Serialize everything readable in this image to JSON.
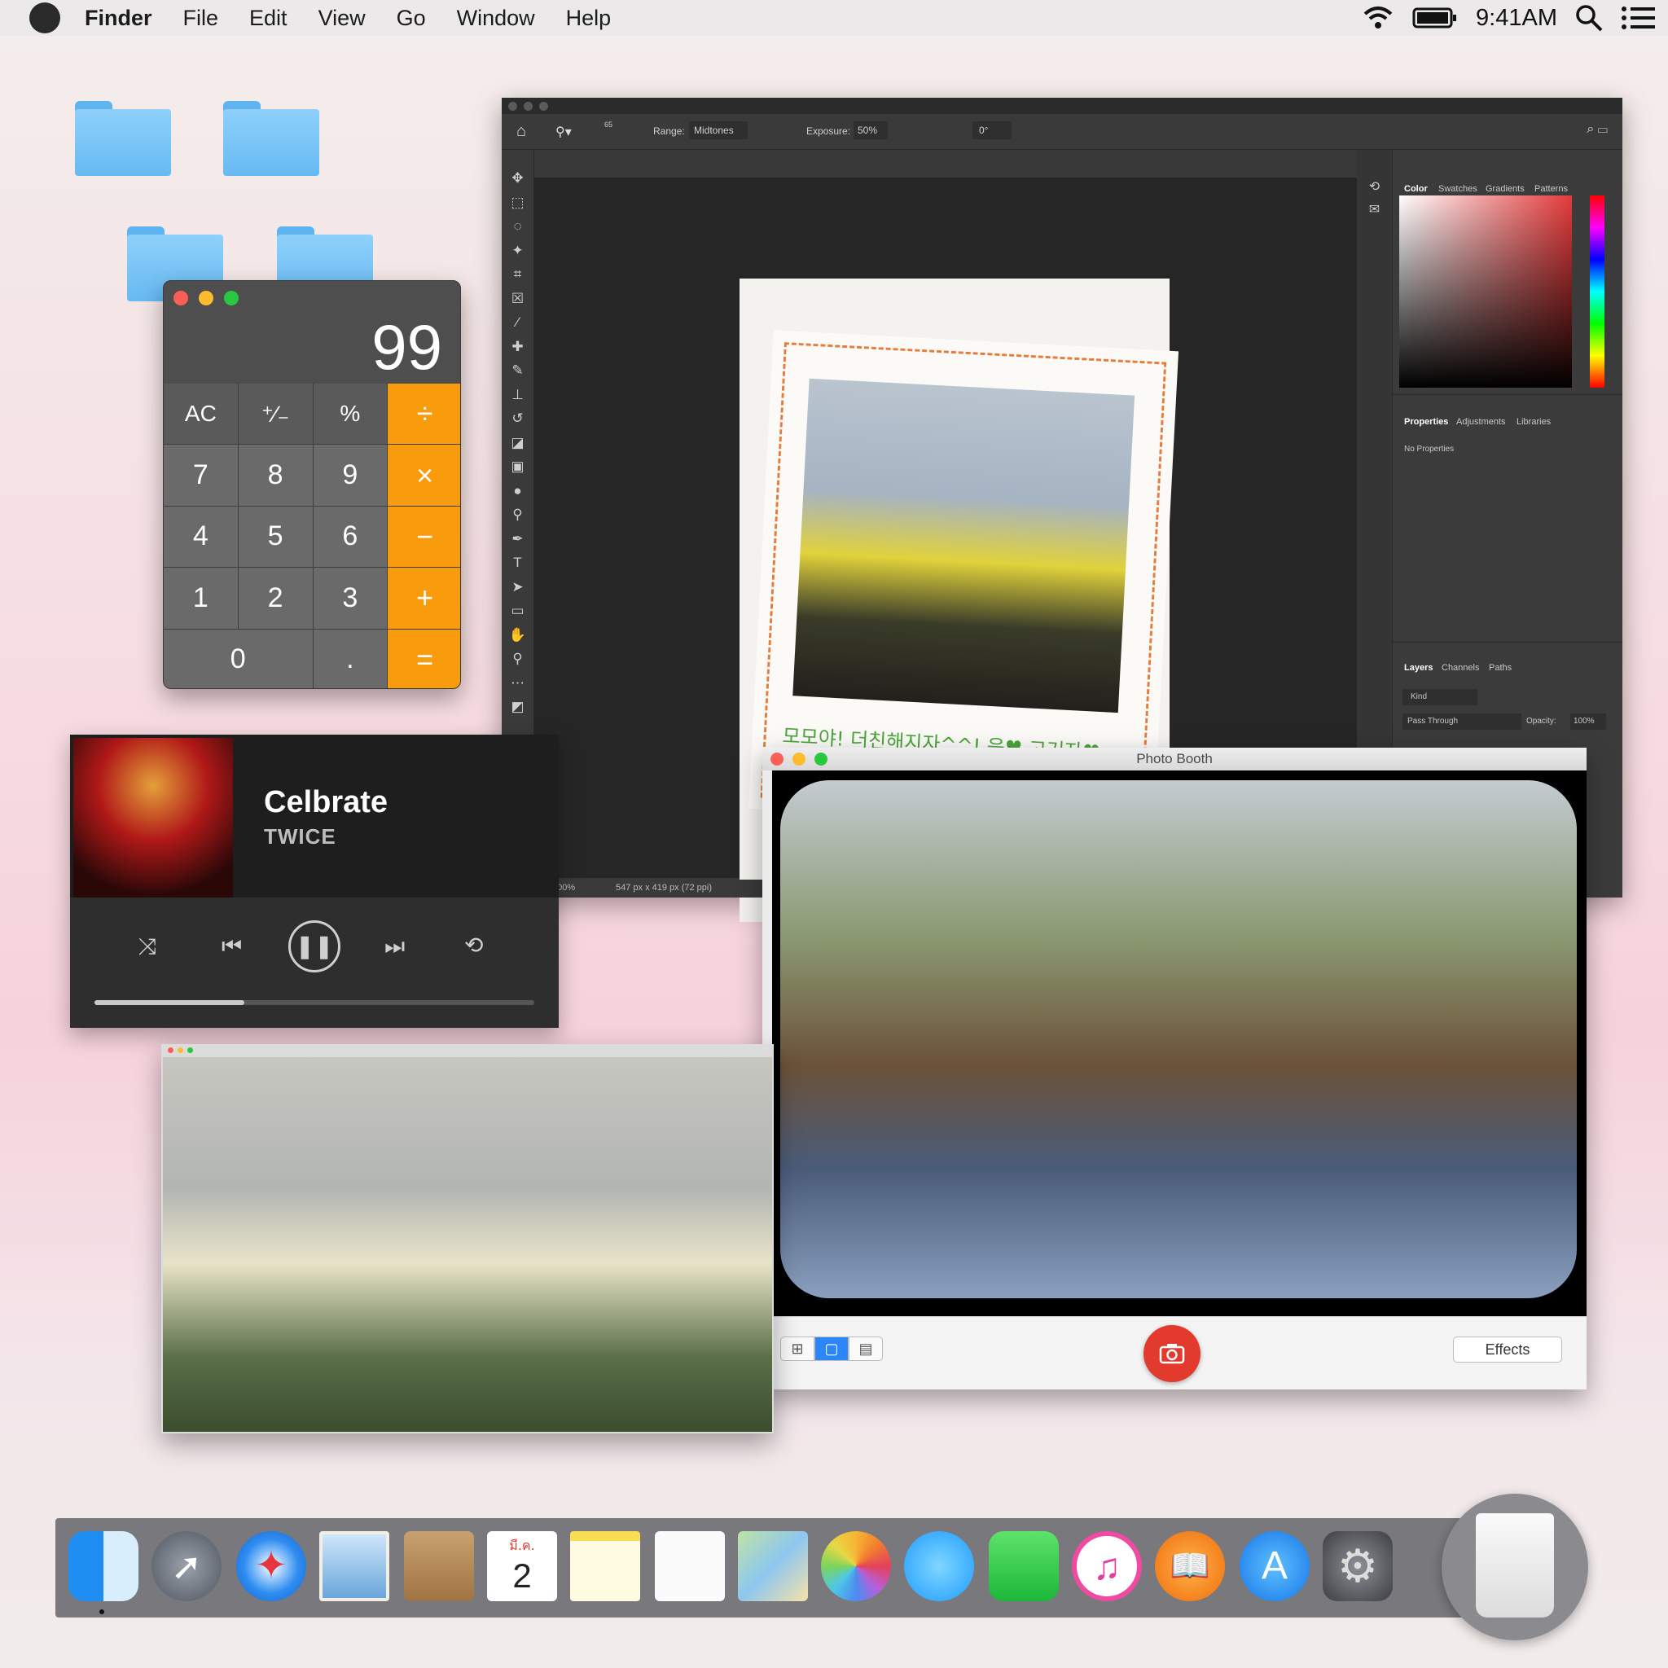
{
  "menubar": {
    "app_name": "Finder",
    "items": [
      "File",
      "Edit",
      "View",
      "Go",
      "Window",
      "Help"
    ],
    "clock": "9:41AM"
  },
  "calculator": {
    "display": "99",
    "keys": [
      "AC",
      "⁺∕₋",
      "%",
      "÷",
      "7",
      "8",
      "9",
      "×",
      "4",
      "5",
      "6",
      "−",
      "1",
      "2",
      "3",
      "+",
      "0",
      ".",
      "="
    ]
  },
  "music": {
    "title": "Celbrate",
    "artist": "TWICE",
    "progress": 0.34
  },
  "photoshop": {
    "options": {
      "range_label": "Range:",
      "range_value": "Midtones",
      "exposure_label": "Exposure:",
      "exposure_value": "50%",
      "angle_value": "0°",
      "brush_size": "65"
    },
    "panels": {
      "color_tabs": [
        "Color",
        "Swatches",
        "Gradients",
        "Patterns"
      ],
      "properties_tabs": [
        "Properties",
        "Adjustments",
        "Libraries"
      ],
      "properties_empty": "No Properties",
      "layers_tabs": [
        "Layers",
        "Channels",
        "Paths"
      ],
      "layers_kind": "Kind",
      "blend_mode": "Pass Through",
      "opacity_label": "Opacity:",
      "opacity_value": "100%"
    },
    "status": {
      "zoom": "100%",
      "doc_info": "547 px x 419 px (72 ppi)"
    },
    "polaroid_caption": "모모야! 더친해지자^^! 응♥ 고거자♥"
  },
  "photobooth": {
    "title": "Photo Booth",
    "effects_label": "Effects"
  },
  "colors": {
    "calc_operator": "#f89c0e",
    "shutter": "#e33a2e",
    "folder": "#6cbdf4"
  },
  "dock": {
    "apps": [
      "Finder",
      "Launchpad",
      "Safari",
      "Mail",
      "Contacts",
      "Calendar",
      "Notes",
      "Reminders",
      "Maps",
      "Photos",
      "Messages",
      "FaceTime",
      "iTunes",
      "iBooks",
      "App Store",
      "System Preferences",
      "Trash"
    ],
    "calendar_month": "มี.ค.",
    "calendar_day": "2"
  }
}
